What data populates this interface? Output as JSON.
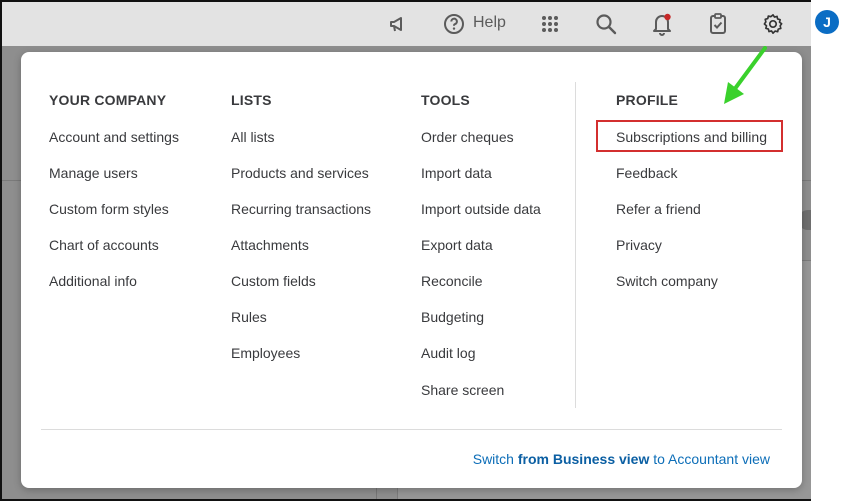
{
  "topbar": {
    "help_label": "Help",
    "avatar_letter": "J"
  },
  "menu": {
    "columns": [
      {
        "title": "YOUR COMPANY",
        "items": [
          "Account and settings",
          "Manage users",
          "Custom form styles",
          "Chart of accounts",
          "Additional info"
        ]
      },
      {
        "title": "LISTS",
        "items": [
          "All lists",
          "Products and services",
          "Recurring transactions",
          "Attachments",
          "Custom fields",
          "Rules",
          "Employees"
        ]
      },
      {
        "title": "TOOLS",
        "items": [
          "Order cheques",
          "Import data",
          "Import outside data",
          "Export data",
          "Reconcile",
          "Budgeting",
          "Audit log",
          "Share screen"
        ]
      },
      {
        "title": "PROFILE",
        "items": [
          "Subscriptions and billing",
          "Feedback",
          "Refer a friend",
          "Privacy",
          "Switch company"
        ]
      }
    ],
    "switch_view": {
      "prefix": "Switch ",
      "bold": "from Business view",
      "suffix": " to Accountant view"
    }
  },
  "colors": {
    "highlight": "#d32f2f",
    "arrow": "#3ad12c",
    "link": "#0d6eb8",
    "avatar": "#0b6dc4"
  }
}
